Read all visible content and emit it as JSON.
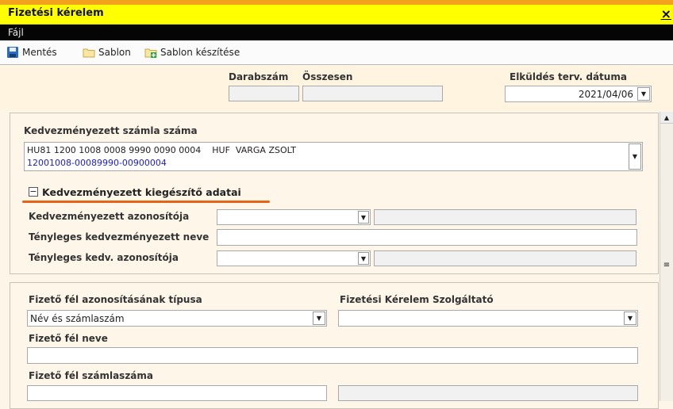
{
  "window": {
    "title": "Fizetési kérelem",
    "close": "×"
  },
  "menu": {
    "file": "Fájl"
  },
  "toolbar": {
    "save": "Mentés",
    "template": "Sablon",
    "make_template": "Sablon készítése"
  },
  "header": {
    "count_label": "Darabszám",
    "total_label": "Összesen",
    "date_label": "Elküldés terv. dátuma",
    "date_value": "2021/04/06"
  },
  "beneficiary": {
    "account_label": "Kedvezményezett számla száma",
    "account_line1": "HU81 1200 1008 0008 9990 0090 0004",
    "currency": "HUF",
    "name": "VARGA ZSOLT",
    "account_line2": "12001008-00089990-00900004",
    "extra_toggle": "−",
    "extra_label": "Kedvezményezett kiegészítő adatai",
    "id_label": "Kedvezményezett azonosítója",
    "actual_name_label": "Tényleges kedvezményezett neve",
    "actual_id_label": "Tényleges kedv. azonosítója"
  },
  "payer": {
    "id_type_label": "Fizető fél azonosításának típusa",
    "id_type_value": "Név és számlaszám",
    "provider_label": "Fizetési Kérelem Szolgáltató",
    "name_label": "Fizető fél neve",
    "account_label": "Fizető fél számlaszáma"
  },
  "colors": {
    "title_bar": "#ffff00",
    "menu_bar": "#050505",
    "underline": "#e8631a",
    "link": "#1a1ae0"
  }
}
